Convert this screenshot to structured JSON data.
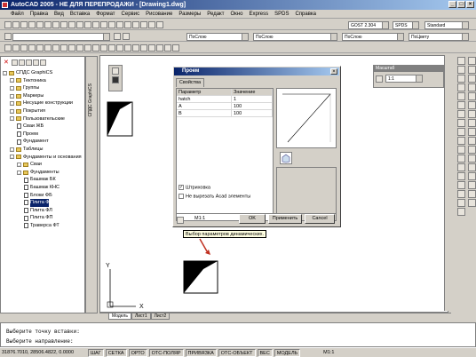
{
  "window": {
    "title": "AutoCAD 2005 - НЕ ДЛЯ ПЕРЕПРОДАЖИ - [Drawing1.dwg]"
  },
  "menu": [
    "Файл",
    "Правка",
    "Вид",
    "Вставка",
    "Формат",
    "Сервис",
    "Рисование",
    "Размеры",
    "Редакт",
    "Окно",
    "Express",
    "SPDS",
    "Справка"
  ],
  "toolbar": {
    "dimstyle": "GOST 2.304",
    "spds": "SPDS",
    "standard": "Standard",
    "layer": "ПоСлою",
    "linetype": "ПоСлою",
    "lineweight": "ПоСлою",
    "color": "ПоЦвету"
  },
  "palette": {
    "tab_label": "СПДС GraphiCS",
    "tree": [
      {
        "label": "СПДС GraphiCS",
        "level": 0,
        "type": "folder"
      },
      {
        "label": "Тектоника",
        "level": 1,
        "type": "folder"
      },
      {
        "label": "Группы",
        "level": 1,
        "type": "folder"
      },
      {
        "label": "Маркеры",
        "level": 1,
        "type": "folder"
      },
      {
        "label": "Несущие конструкции",
        "level": 1,
        "type": "folder"
      },
      {
        "label": "Покрытия",
        "level": 1,
        "type": "folder"
      },
      {
        "label": "Пользовательские",
        "level": 1,
        "type": "folder"
      },
      {
        "label": "Сваи ЖБ",
        "level": 2,
        "type": "doc"
      },
      {
        "label": "Проем",
        "level": 2,
        "type": "doc"
      },
      {
        "label": "Фундамент",
        "level": 2,
        "type": "doc"
      },
      {
        "label": "Таблицы",
        "level": 1,
        "type": "folder"
      },
      {
        "label": "Фундаменты и основания",
        "level": 1,
        "type": "folder"
      },
      {
        "label": "Сваи",
        "level": 2,
        "type": "folder"
      },
      {
        "label": "Фундаменты",
        "level": 2,
        "type": "folder"
      },
      {
        "label": "Башмак БК",
        "level": 3,
        "type": "doc"
      },
      {
        "label": "Башмак КНС",
        "level": 3,
        "type": "doc"
      },
      {
        "label": "Блоки ФБ",
        "level": 3,
        "type": "doc"
      },
      {
        "label": "Плита Ф",
        "level": 3,
        "type": "doc",
        "selected": true
      },
      {
        "label": "Плита ФЛ",
        "level": 3,
        "type": "doc"
      },
      {
        "label": "Плита ФП",
        "level": 3,
        "type": "doc"
      },
      {
        "label": "Траверса ФТ",
        "level": 3,
        "type": "doc"
      }
    ]
  },
  "dialog": {
    "title": "Проем",
    "tab": "Свойства",
    "col_param": "Параметр",
    "col_value": "Значение",
    "rows": [
      {
        "p": "hatch",
        "v": "1"
      },
      {
        "p": "A",
        "v": "100"
      },
      {
        "p": "B",
        "v": "100"
      }
    ],
    "chk_hatch": "Штриховка",
    "chk_cut": "Не вырезать Acad элементы",
    "scale": "М1:1",
    "ok": "OK",
    "apply": "Применить",
    "cancel": "Cancel"
  },
  "tooltip": "Выбор параметров динамических.",
  "masshtab": {
    "title": "Масштаб",
    "value": "1:1"
  },
  "ucs": {
    "x": "X",
    "y": "Y"
  },
  "layout_tabs": [
    "Модель",
    "Лист1",
    "Лист2"
  ],
  "command": {
    "line1": "Выберите точку вставки:",
    "line2": "Выберите направление:"
  },
  "status": {
    "coords": "31876.7010, 28506.4822, 0.0000",
    "items": [
      "ШАГ",
      "СЕТКА",
      "ОРТО",
      "ОТС-ПОЛЯР",
      "ПРИВЯЗКА",
      "ОТС-ОБЪЕКТ",
      "ВЕС",
      "МОДЕЛЬ"
    ],
    "scale": "М1:1"
  }
}
